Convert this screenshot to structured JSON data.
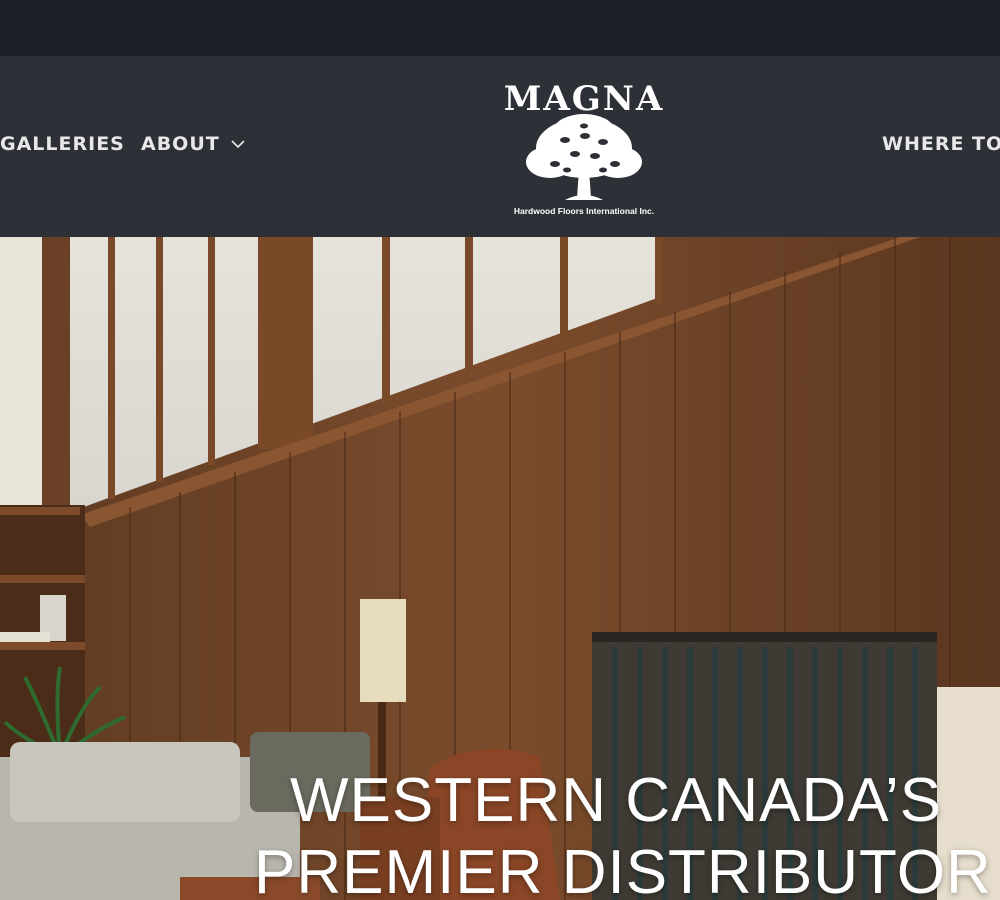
{
  "nav": {
    "galleries_label": "GALLERIES",
    "about_label": "ABOUT",
    "where_label": "WHERE TO"
  },
  "logo": {
    "wordmark": "MAGNA",
    "tagline": "Hardwood Floors International Inc."
  },
  "hero": {
    "heading_line1": "WESTERN CANADA’S",
    "heading_line2": "PREMIER DISTRIBUTOR"
  },
  "colors": {
    "topbar": "#1e2027",
    "header": "#2e3038",
    "nav_text": "#e8e8e8",
    "wood": "#7a4a2a"
  }
}
